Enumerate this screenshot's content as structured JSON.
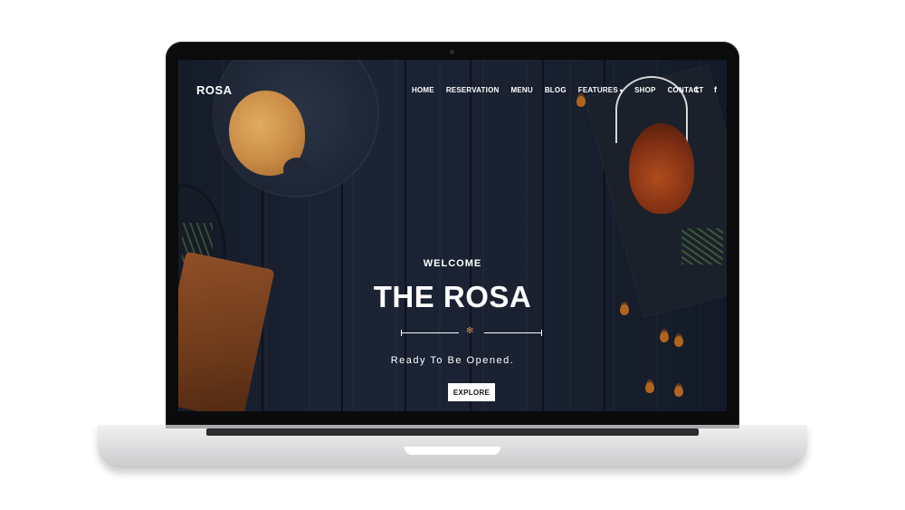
{
  "site": {
    "logo": "ROSA",
    "menu": [
      "HOME",
      "RESERVATION",
      "MENU",
      "BLOG",
      "FEATURES",
      "SHOP",
      "CONTACT"
    ],
    "features_caret": "▾",
    "social": {
      "twitter": "𝕥",
      "facebook": "f"
    }
  },
  "hero": {
    "welcome": "WELCOME",
    "title": "THE ROSA",
    "ornament": "✻",
    "tagline": "Ready To Be Opened.",
    "cta": "EXPLORE"
  },
  "colors": {
    "background": "#1a2232",
    "accent": "#c38a56",
    "text": "#ffffff"
  }
}
